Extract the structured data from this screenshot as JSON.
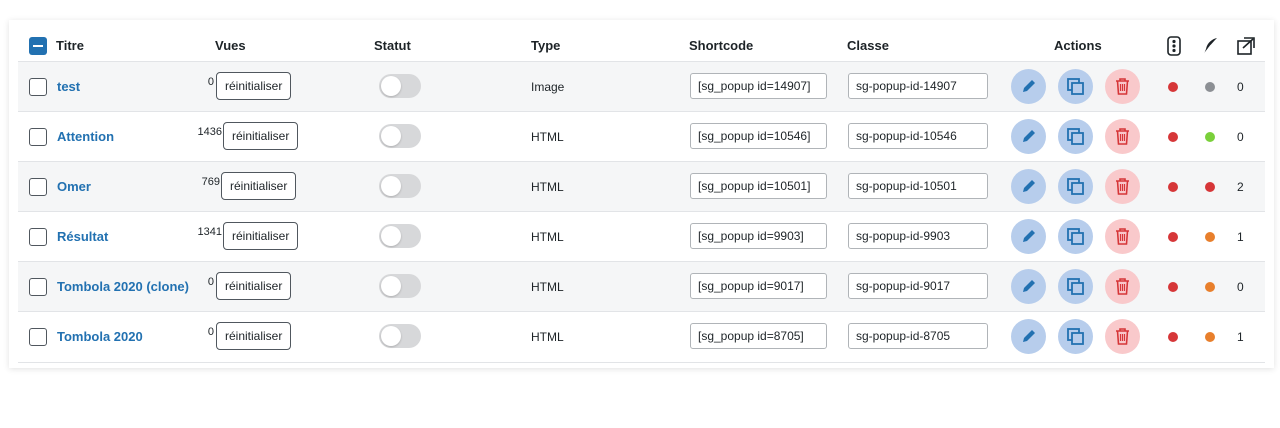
{
  "columns": {
    "title": "Titre",
    "views": "Vues",
    "status": "Statut",
    "type": "Type",
    "shortcode": "Shortcode",
    "class": "Classe",
    "actions": "Actions"
  },
  "header_icons": [
    "traffic-light-icon",
    "feather-icon",
    "popup-open-icon"
  ],
  "reset_label": "réinitialiser",
  "colors": {
    "link": "#2271b1",
    "red": "#d63638",
    "green": "#7ad03a",
    "orange": "#e87f2c",
    "grey": "#8c8f94"
  },
  "rows": [
    {
      "title": "test",
      "views": "0",
      "type": "Image",
      "shortcode": "[sg_popup id=14907]",
      "class": "sg-popup-id-14907",
      "dot1": "red",
      "dot2": "grey",
      "count": "0",
      "active": false
    },
    {
      "title": "Attention",
      "views": "1436",
      "type": "HTML",
      "shortcode": "[sg_popup id=10546]",
      "class": "sg-popup-id-10546",
      "dot1": "red",
      "dot2": "green",
      "count": "0",
      "active": false
    },
    {
      "title": "Omer",
      "views": "769",
      "type": "HTML",
      "shortcode": "[sg_popup id=10501]",
      "class": "sg-popup-id-10501",
      "dot1": "red",
      "dot2": "red",
      "count": "2",
      "active": false
    },
    {
      "title": "Résultat",
      "views": "1341",
      "type": "HTML",
      "shortcode": "[sg_popup id=9903]",
      "class": "sg-popup-id-9903",
      "dot1": "red",
      "dot2": "orange",
      "count": "1",
      "active": false
    },
    {
      "title": "Tombola 2020 (clone)",
      "views": "0",
      "type": "HTML",
      "shortcode": "[sg_popup id=9017]",
      "class": "sg-popup-id-9017",
      "dot1": "red",
      "dot2": "orange",
      "count": "0",
      "active": false
    },
    {
      "title": "Tombola 2020",
      "views": "0",
      "type": "HTML",
      "shortcode": "[sg_popup id=8705]",
      "class": "sg-popup-id-8705",
      "dot1": "red",
      "dot2": "orange",
      "count": "1",
      "active": false
    }
  ]
}
